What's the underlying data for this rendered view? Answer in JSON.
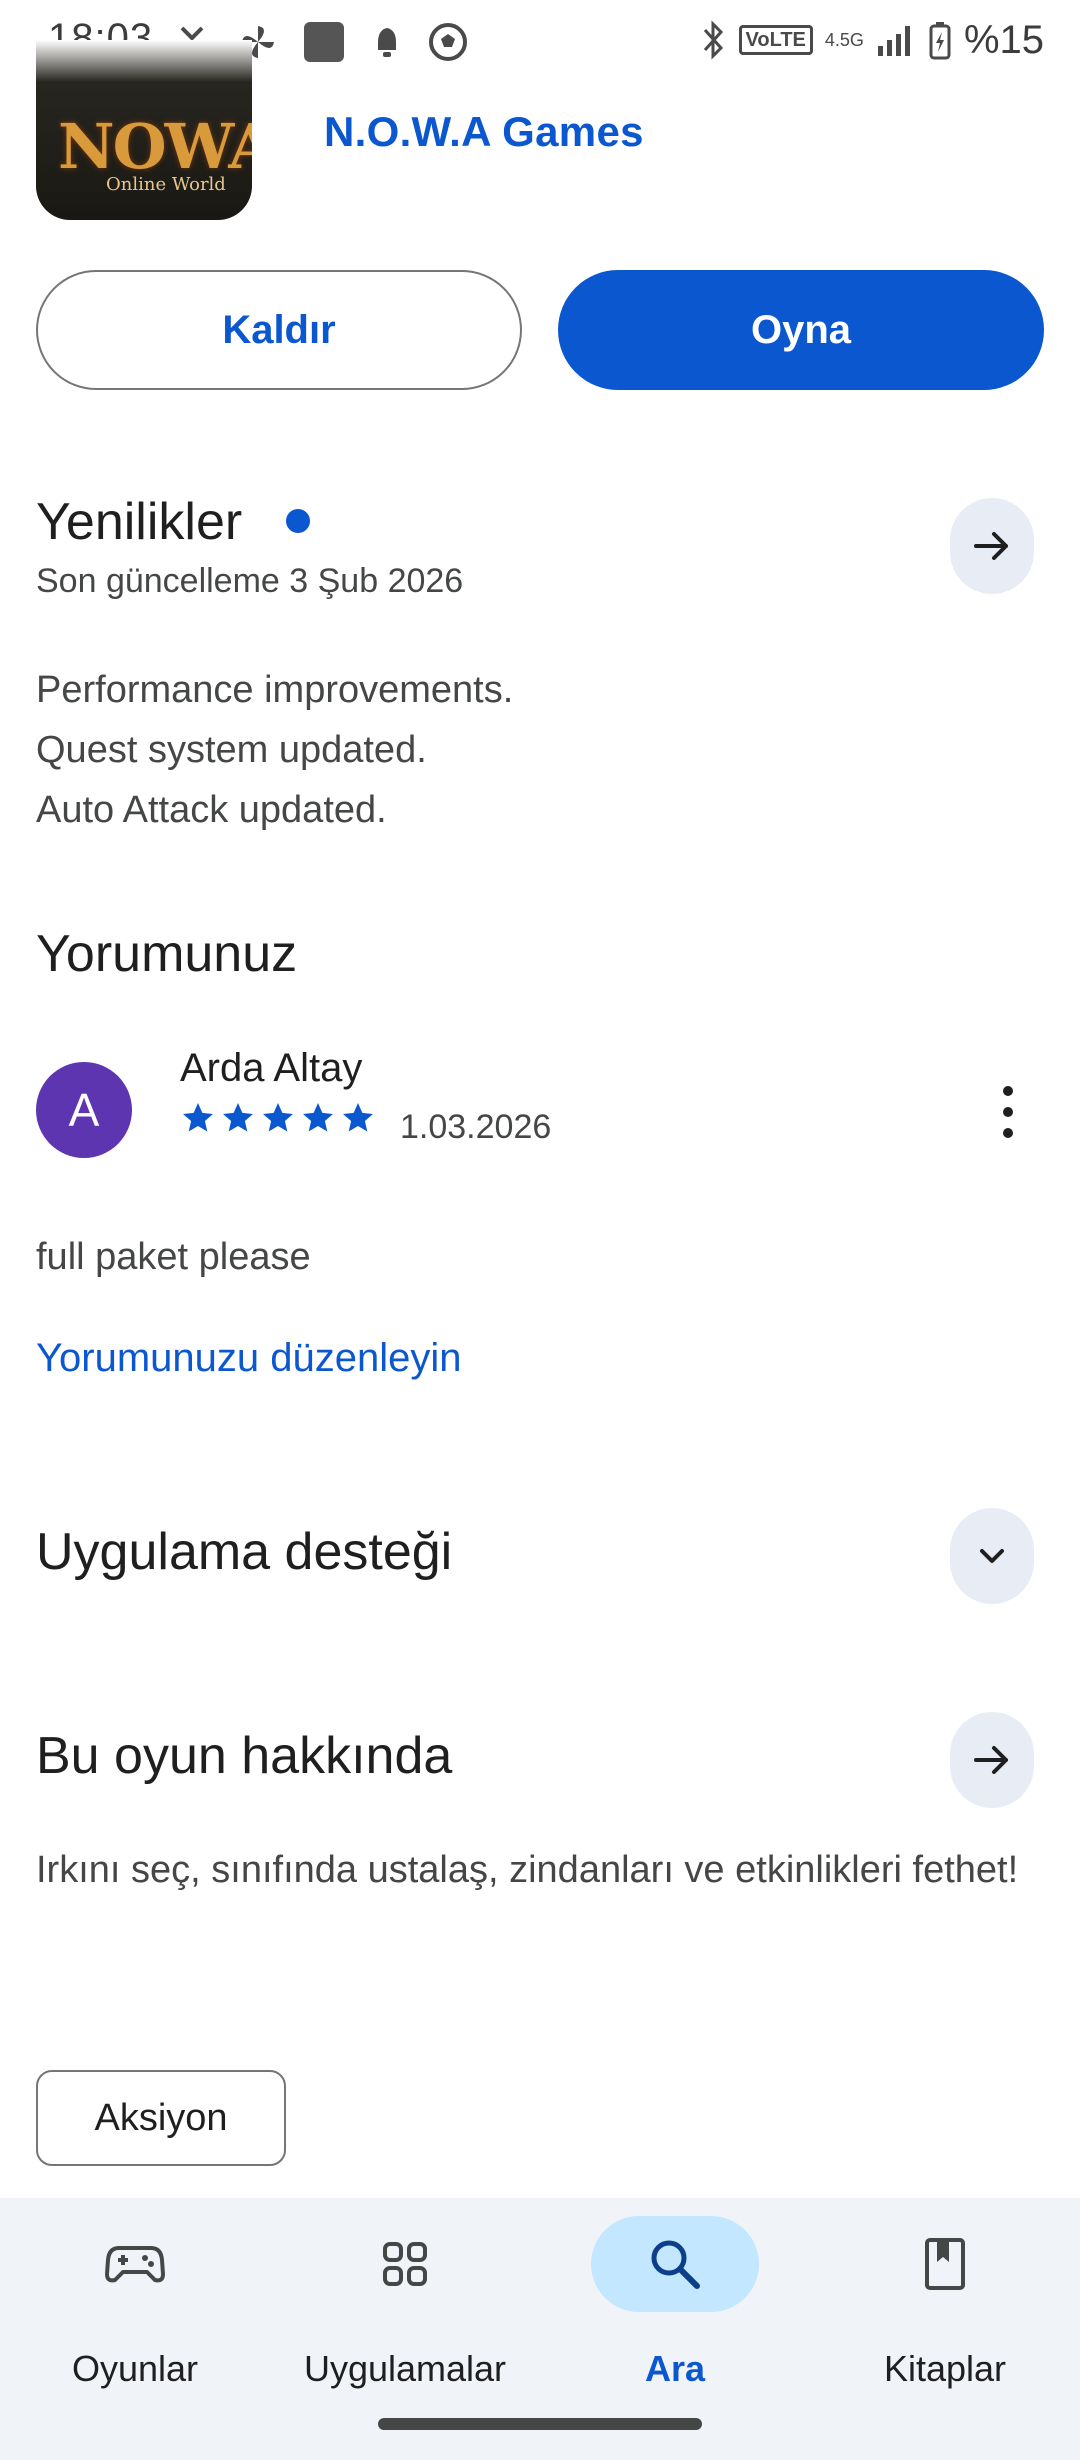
{
  "status_bar": {
    "time": "18:03",
    "left_icons": [
      "missed-call-icon",
      "pinwheel-icon",
      "app-square-icon",
      "notification-bell-icon",
      "soccer-ball-icon"
    ],
    "right_icons": [
      "bluetooth-icon",
      "volte-icon",
      "signal-icon",
      "battery-charging-icon"
    ],
    "volte_label": "VoLTE",
    "network_type": "4.5G",
    "battery": "%15"
  },
  "app": {
    "icon_text": "NOWA",
    "icon_subtext": "Online World",
    "developer": "N.O.W.A Games",
    "uninstall_label": "Kaldır",
    "play_label": "Oyna"
  },
  "whats_new": {
    "title": "Yenilikler",
    "last_update": "Son güncelleme 3 Şub 2026",
    "notes": [
      "Performance improvements.",
      "Quest system updated.",
      "Auto Attack updated."
    ]
  },
  "review": {
    "title": "Yorumunuz",
    "avatar_letter": "A",
    "reviewer": "Arda Altay",
    "rating": 5,
    "date": "1.03.2026",
    "text": "full paket please",
    "edit_label": "Yorumunuzu düzenleyin"
  },
  "support": {
    "title": "Uygulama desteği"
  },
  "about": {
    "title": "Bu oyun hakkında",
    "description": "Irkını seç, sınıfında ustalaş, zindanları ve etkinlikleri fethet!",
    "tag": "Aksiyon"
  },
  "nav": {
    "items": [
      {
        "label": "Oyunlar",
        "icon": "gamepad-icon",
        "active": false
      },
      {
        "label": "Uygulamalar",
        "icon": "apps-grid-icon",
        "active": false
      },
      {
        "label": "Ara",
        "icon": "search-icon",
        "active": true
      },
      {
        "label": "Kitaplar",
        "icon": "book-icon",
        "active": false
      }
    ]
  },
  "colors": {
    "accent": "#0b57d0",
    "avatar": "#5e35b1",
    "nav_bg": "#f0f4f9",
    "active_pill": "#c2e7ff"
  }
}
